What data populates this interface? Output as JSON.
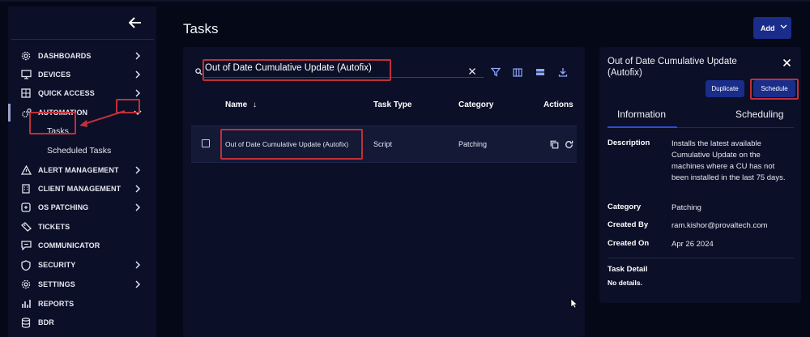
{
  "colors": {
    "background": "#050817",
    "panel": "#0b0f27",
    "accent_button": "#1a2d8a",
    "highlight_box": "#c0303a",
    "tab_underline": "#2f4bd8"
  },
  "sidebar": {
    "items": [
      {
        "label": "DASHBOARDS",
        "icon": "gear-icon",
        "has_chevron": true
      },
      {
        "label": "DEVICES",
        "icon": "monitor-icon",
        "has_chevron": true
      },
      {
        "label": "QUICK ACCESS",
        "icon": "grid-icon",
        "has_chevron": true
      },
      {
        "label": "AUTOMATION",
        "icon": "cogs-icon",
        "has_chevron": true,
        "expanded": true
      },
      {
        "label": "ALERT MANAGEMENT",
        "icon": "warning-icon",
        "has_chevron": true
      },
      {
        "label": "CLIENT MANAGEMENT",
        "icon": "building-icon",
        "has_chevron": true
      },
      {
        "label": "OS PATCHING",
        "icon": "patch-icon",
        "has_chevron": true
      },
      {
        "label": "TICKETS",
        "icon": "ticket-icon",
        "has_chevron": false
      },
      {
        "label": "COMMUNICATOR",
        "icon": "chat-icon",
        "has_chevron": false
      },
      {
        "label": "SECURITY",
        "icon": "shield-icon",
        "has_chevron": true
      },
      {
        "label": "SETTINGS",
        "icon": "gear-icon",
        "has_chevron": true
      },
      {
        "label": "REPORTS",
        "icon": "bar-chart-icon",
        "has_chevron": false
      },
      {
        "label": "BDR",
        "icon": "database-icon",
        "has_chevron": false
      }
    ],
    "automation_sub": [
      {
        "label": "Tasks",
        "active": true
      },
      {
        "label": "Scheduled Tasks",
        "active": false
      }
    ]
  },
  "header": {
    "title": "Tasks",
    "add_label": "Add"
  },
  "search": {
    "value": "Out of Date Cumulative Update (Autofix)",
    "placeholder": ""
  },
  "toolbar": {
    "icons": [
      "filter-icon",
      "columns-icon",
      "density-icon",
      "download-icon"
    ]
  },
  "table": {
    "columns": {
      "name": "Name",
      "task_type": "Task Type",
      "category": "Category",
      "actions": "Actions"
    },
    "sort_indicator": "↓",
    "rows": [
      {
        "name": "Out of Date Cumulative Update (Autofix)",
        "task_type": "Script",
        "category": "Patching"
      }
    ]
  },
  "detail": {
    "title": "Out of Date Cumulative Update (Autofix)",
    "duplicate_label": "Duplicate",
    "schedule_label": "Schedule",
    "tabs": [
      "Information",
      "Scheduling"
    ],
    "fields": {
      "description_label": "Description",
      "description": "Installs the latest available Cumulative Update on the machines where a CU has not been installed in the last 75 days.",
      "category_label": "Category",
      "category": "Patching",
      "created_by_label": "Created By",
      "created_by": "ram.kishor@provaltech.com",
      "created_on_label": "Created On",
      "created_on": "Apr 26 2024",
      "task_detail_label": "Task Detail",
      "task_detail": "No details."
    }
  }
}
